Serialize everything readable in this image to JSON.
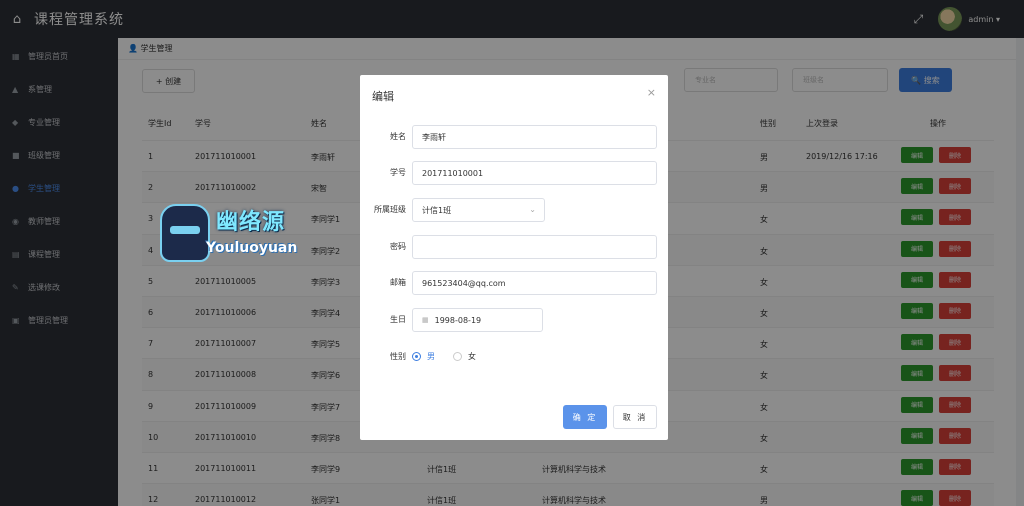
{
  "header": {
    "title": "课程管理系统",
    "user": "admin ▾",
    "home_icon": "⌂",
    "fullscreen_icon": "⤢"
  },
  "sidebar": {
    "items": [
      {
        "icon": "▦",
        "label": "管理员首页"
      },
      {
        "icon": "▲",
        "label": "系管理"
      },
      {
        "icon": "◆",
        "label": "专业管理"
      },
      {
        "icon": "■",
        "label": "班级管理"
      },
      {
        "icon": "●",
        "label": "学生管理"
      },
      {
        "icon": "◉",
        "label": "教师管理"
      },
      {
        "icon": "▤",
        "label": "课程管理"
      },
      {
        "icon": "✎",
        "label": "选课修改"
      },
      {
        "icon": "▣",
        "label": "管理员管理"
      }
    ]
  },
  "breadcrumb": "👤 学生管理",
  "toolbar": {
    "create_label": "+ 创建",
    "major_placeholder": "专业名",
    "class_placeholder": "班级名",
    "search_label": "🔍 搜索"
  },
  "table": {
    "headers": [
      "学生Id",
      "学号",
      "姓名",
      "性别",
      "上次登录",
      "操作"
    ],
    "edit_label": "编辑",
    "delete_label": "删除",
    "rows": [
      {
        "id": "1",
        "no": "201711010001",
        "name": "李雨轩",
        "cls": "",
        "major": "",
        "gender": "男",
        "last": "2019/12/16 17:16"
      },
      {
        "id": "2",
        "no": "201711010002",
        "name": "宋智",
        "cls": "",
        "major": "",
        "gender": "男",
        "last": ""
      },
      {
        "id": "3",
        "no": "",
        "name": "李同学1",
        "cls": "",
        "major": "",
        "gender": "女",
        "last": ""
      },
      {
        "id": "4",
        "no": "",
        "name": "李同学2",
        "cls": "",
        "major": "",
        "gender": "女",
        "last": ""
      },
      {
        "id": "5",
        "no": "201711010005",
        "name": "李同学3",
        "cls": "",
        "major": "",
        "gender": "女",
        "last": ""
      },
      {
        "id": "6",
        "no": "201711010006",
        "name": "李同学4",
        "cls": "",
        "major": "",
        "gender": "女",
        "last": ""
      },
      {
        "id": "7",
        "no": "201711010007",
        "name": "李同学5",
        "cls": "",
        "major": "",
        "gender": "女",
        "last": ""
      },
      {
        "id": "8",
        "no": "201711010008",
        "name": "李同学6",
        "cls": "",
        "major": "",
        "gender": "女",
        "last": ""
      },
      {
        "id": "9",
        "no": "201711010009",
        "name": "李同学7",
        "cls": "",
        "major": "",
        "gender": "女",
        "last": ""
      },
      {
        "id": "10",
        "no": "201711010010",
        "name": "李同学8",
        "cls": "",
        "major": "",
        "gender": "女",
        "last": ""
      },
      {
        "id": "11",
        "no": "201711010011",
        "name": "李同学9",
        "cls": "计信1班",
        "major": "计算机科学与技术",
        "gender": "女",
        "last": ""
      },
      {
        "id": "12",
        "no": "201711010012",
        "name": "张同学1",
        "cls": "计信1班",
        "major": "计算机科学与技术",
        "gender": "男",
        "last": ""
      }
    ]
  },
  "watermark": {
    "cn": "幽络源",
    "en": "Youluoyuan"
  },
  "dialog": {
    "title": "编辑",
    "close": "×",
    "fields": {
      "name_label": "姓名",
      "name_value": "李雨轩",
      "no_label": "学号",
      "no_value": "201711010001",
      "class_label": "所属班级",
      "class_value": "计信1班",
      "pwd_label": "密码",
      "pwd_value": "",
      "email_label": "邮箱",
      "email_value": "961523404@qq.com",
      "birth_label": "生日",
      "birth_value": "1998-08-19",
      "gender_label": "性别",
      "gender_male": "男",
      "gender_female": "女"
    },
    "ok_label": "确 定",
    "cancel_label": "取 消"
  }
}
